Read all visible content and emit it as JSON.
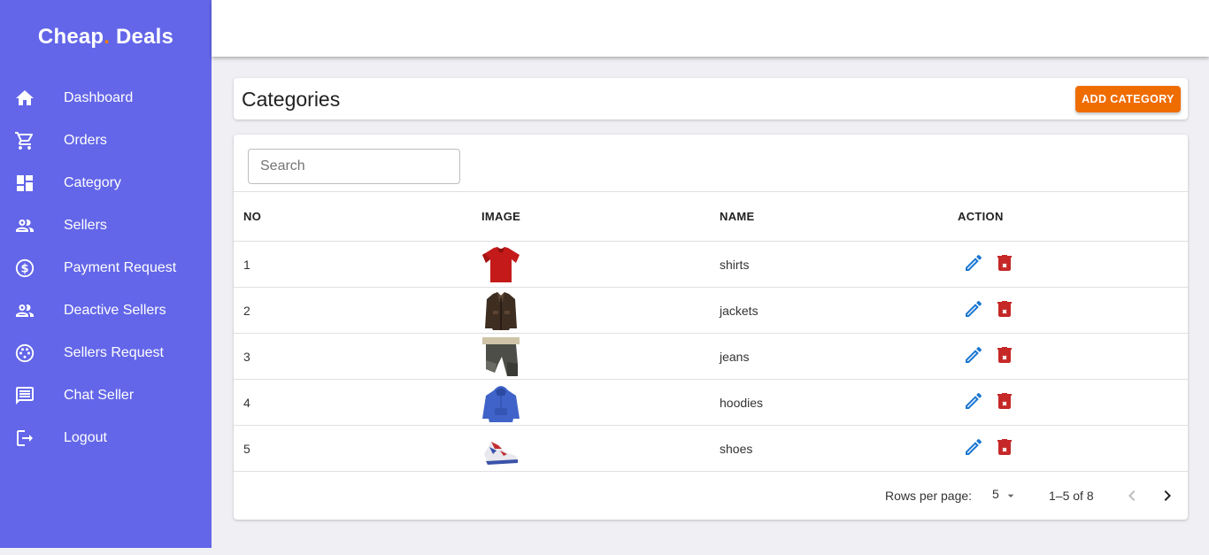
{
  "brand": {
    "part1": "Cheap",
    "dot": ".",
    "part2": " Deals"
  },
  "sidebar": {
    "items": [
      {
        "label": "Dashboard",
        "icon": "home-icon"
      },
      {
        "label": "Orders",
        "icon": "cart-icon"
      },
      {
        "label": "Category",
        "icon": "dashboard-grid-icon"
      },
      {
        "label": "Sellers",
        "icon": "people-icon"
      },
      {
        "label": "Payment Request",
        "icon": "dollar-circle-icon"
      },
      {
        "label": "Deactive Sellers",
        "icon": "people-icon"
      },
      {
        "label": "Sellers Request",
        "icon": "palette-icon"
      },
      {
        "label": "Chat Seller",
        "icon": "chat-icon"
      },
      {
        "label": "Logout",
        "icon": "logout-icon"
      }
    ]
  },
  "header": {
    "title": "Categories",
    "add_label": "ADD CATEGORY"
  },
  "search": {
    "placeholder": "Search",
    "value": ""
  },
  "table": {
    "columns": [
      "NO",
      "IMAGE",
      "NAME",
      "ACTION"
    ],
    "rows": [
      {
        "no": "1",
        "name": "shirts",
        "image": "red-shirt"
      },
      {
        "no": "2",
        "name": "jackets",
        "image": "brown-jacket"
      },
      {
        "no": "3",
        "name": "jeans",
        "image": "jeans"
      },
      {
        "no": "4",
        "name": "hoodies",
        "image": "blue-hoodie"
      },
      {
        "no": "5",
        "name": "shoes",
        "image": "sneakers"
      }
    ]
  },
  "pagination": {
    "rows_per_page_label": "Rows per page:",
    "rows_per_page": "5",
    "range": "1–5 of 8"
  },
  "colors": {
    "sidebar_bg": "#6366e8",
    "accent": "#ef6c00",
    "edit": "#1976d2",
    "delete": "#c62828"
  }
}
